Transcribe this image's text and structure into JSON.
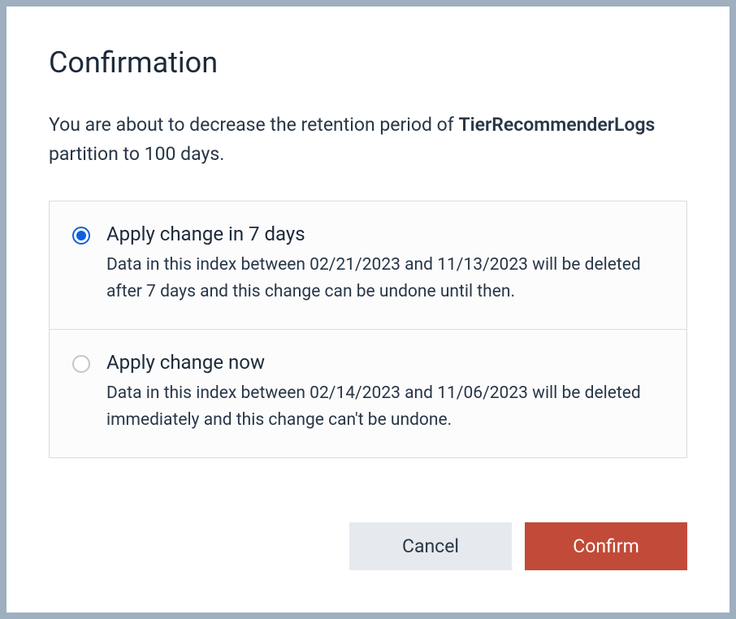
{
  "dialog": {
    "title": "Confirmation",
    "body_prefix": "You are about to decrease the retention period of ",
    "partition_name": "TierRecommenderLogs",
    "body_suffix": " partition to 100 days."
  },
  "options": [
    {
      "title": "Apply change in 7 days",
      "desc": "Data in this index between 02/21/2023 and 11/13/2023 will be deleted after 7 days and this change can be undone until then.",
      "selected": true
    },
    {
      "title": "Apply change now",
      "desc": "Data in this index between 02/14/2023 and 11/06/2023 will be deleted immediately and this change can't be undone.",
      "selected": false
    }
  ],
  "actions": {
    "cancel": "Cancel",
    "confirm": "Confirm"
  }
}
